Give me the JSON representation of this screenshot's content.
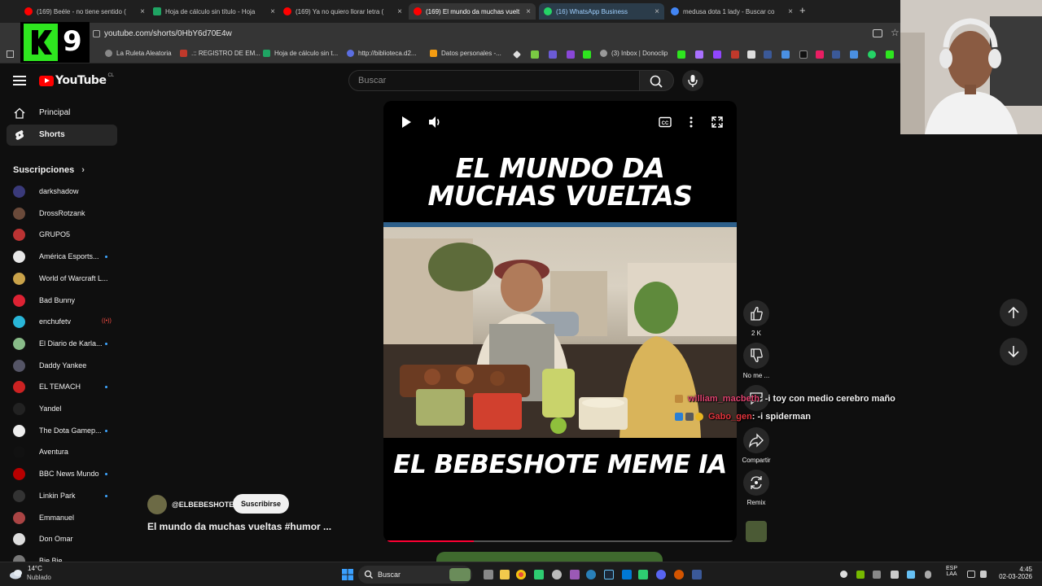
{
  "browser": {
    "tabs": [
      {
        "title": "(169) Beéle - no tiene sentido (",
        "fav": "#ff0000"
      },
      {
        "title": "Hoja de cálculo sin título - Hoja",
        "fav": "#1fa463"
      },
      {
        "title": "(169) Ya no quiero llorar letra (",
        "fav": "#ff0000"
      },
      {
        "title": "(169) El mundo da muchas vuelt",
        "fav": "#ff0000"
      },
      {
        "title": "(16) WhatsApp Business",
        "fav": "#25d366"
      },
      {
        "title": "medusa dota 1 lady - Buscar co",
        "fav": "#4285f4"
      }
    ],
    "new_tab_label": "+",
    "close_glyph": "×",
    "url": "youtube.com/shorts/0HbY6d70E4w",
    "bookmarks": [
      {
        "label": "La Ruleta Aleatoria",
        "color": "#888"
      },
      {
        "label": ".:: REGISTRO DE EM...",
        "color": "#c0392b"
      },
      {
        "label": "Hoja de cálculo sin t...",
        "color": "#1fa463"
      },
      {
        "label": "http://biblioteca.d2...",
        "color": "#5b6ee1"
      },
      {
        "label": "Datos personales -...",
        "color": "#f39c12"
      },
      {
        "label": "(3) Inbox | Donoclip",
        "color": "#999"
      }
    ]
  },
  "overlay": {
    "k9_digit": "9"
  },
  "youtube": {
    "logo_text": "YouTube",
    "country": "CL",
    "search_placeholder": "Buscar",
    "nav": [
      {
        "label": "Principal"
      },
      {
        "label": "Shorts"
      }
    ],
    "subscriptions_title": "Suscripciones",
    "subscriptions": [
      {
        "name": "darkshadow",
        "color": "#3a3a7a",
        "dot": false
      },
      {
        "name": "DrossRotzank",
        "color": "#6a4a3a",
        "dot": false
      },
      {
        "name": "GRUPO5",
        "color": "#b33",
        "dot": false
      },
      {
        "name": "América Esports...",
        "color": "#e8e8e8",
        "dot": true
      },
      {
        "name": "World of Warcraft L...",
        "color": "#caa34a",
        "dot": false
      },
      {
        "name": "Bad Bunny",
        "color": "#d23",
        "dot": false
      },
      {
        "name": "enchufetv",
        "color": "#29b6d8",
        "dot": false,
        "live": true
      },
      {
        "name": "El Diario de Karla...",
        "color": "#8b8",
        "dot": true
      },
      {
        "name": "Daddy Yankee",
        "color": "#556",
        "dot": false
      },
      {
        "name": "EL TEMACH",
        "color": "#c22",
        "dot": true
      },
      {
        "name": "Yandel",
        "color": "#222",
        "dot": false
      },
      {
        "name": "The Dota Gamep...",
        "color": "#eee",
        "dot": true
      },
      {
        "name": "Aventura",
        "color": "#111",
        "dot": false
      },
      {
        "name": "BBC News Mundo",
        "color": "#b80000",
        "dot": true
      },
      {
        "name": "Linkin Park",
        "color": "#333",
        "dot": true
      },
      {
        "name": "Emmanuel",
        "color": "#a44",
        "dot": false
      },
      {
        "name": "Don Omar",
        "color": "#ddd",
        "dot": false
      },
      {
        "name": "Bie Bie",
        "color": "#777",
        "dot": false
      }
    ],
    "short": {
      "headline_top_1": "EL MUNDO DA",
      "headline_top_2": "MUCHAS VUELTAS",
      "headline_bottom": "EL BEBESHOTE MEME IA",
      "channel": "@ELBEBESHOTE",
      "subscribe_label": "Suscribirse",
      "title": "El mundo da muchas vueltas  #humor ...",
      "progress": 0.25
    },
    "actions": {
      "like_count": "2 K",
      "dislike_label": "No me ...",
      "share_label": "Compartir",
      "remix_label": "Remix"
    }
  },
  "chat": [
    {
      "user": "william_macbeth",
      "message": ": -i toy con medio cerebro maño"
    },
    {
      "user": "Gabo_gen",
      "message": ": -i spiderman"
    }
  ],
  "taskbar": {
    "weather_temp": "14°C",
    "weather_desc": "Nublado",
    "search_placeholder": "Buscar",
    "lang_1": "ESP",
    "lang_2": "LAA",
    "time": "4:45",
    "date": "02-03-2026"
  }
}
